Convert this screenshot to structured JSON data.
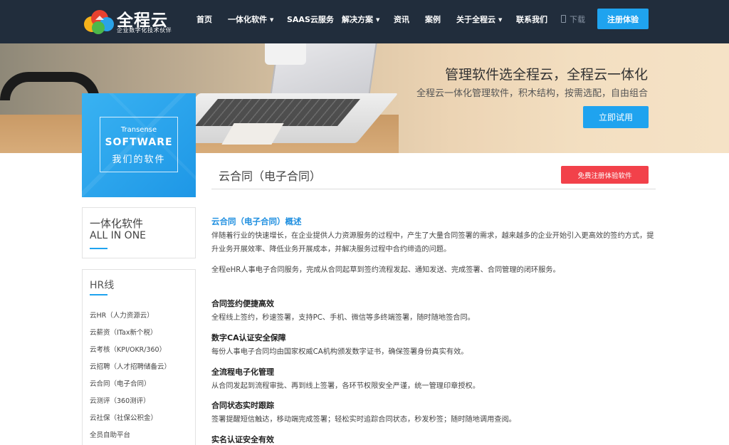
{
  "nav": {
    "logo_title": "全程云",
    "logo_subtitle": "企业数字化技术伙伴",
    "items": [
      {
        "label": "首页",
        "dropdown": false
      },
      {
        "label": "一体化软件",
        "dropdown": true
      },
      {
        "label": "SAAS云服务",
        "dropdown": false
      },
      {
        "label": "解决方案",
        "dropdown": true
      },
      {
        "label": "资讯",
        "dropdown": false
      },
      {
        "label": "案例",
        "dropdown": false
      },
      {
        "label": "关于全程云",
        "dropdown": true
      },
      {
        "label": "联系我们",
        "dropdown": false
      }
    ],
    "download": "下载",
    "register": "注册体验"
  },
  "banner": {
    "title": "管理软件选全程云，全程云一体化",
    "subtitle": "全程云一体化管理软件，积木结构，按需选配，自由组合",
    "button": "立即试用"
  },
  "software_box": {
    "en_small": "Transense",
    "en_big": "SOFTWARE",
    "cn": "我们的软件"
  },
  "sidebar": {
    "allinone_cn": "一体化软件",
    "allinone_en": "ALL IN ONE",
    "hr_title": "HR线",
    "hr_links": [
      "云HR（人力资源云）",
      "云薪资（ITax新个税）",
      "云考核（KPI/OKR/360）",
      "云招聘（人才招聘储备云）",
      "云合同（电子合同）",
      "云测评（360测评）",
      "云社保（社保公积金）",
      "全员自助平台"
    ]
  },
  "main": {
    "title": "云合同（电子合同）",
    "free_button": "免费注册体验软件",
    "overview_title": "云合同（电子合同）概述",
    "para1": "伴随着行业的快速增长，在企业提供人力资源服务的过程中，产生了大量合同签署的需求，越来越多的企业开始引入更高效的签约方式，提升业务开展效率、降低业务开展成本，并解决服务过程中合约缔造的问题。",
    "para2": "全程eHR人事电子合同服务，完成从合同起草到签约流程发起、通知发送、完成签署、合同管理的闭环服务。",
    "features": [
      {
        "title": "合同签约便捷高效",
        "desc": "全程线上签约，秒速签署，支持PC、手机、微信等多终端签署，随时随地签合同。"
      },
      {
        "title": "数字CA认证安全保障",
        "desc": "每份人事电子合同均由国家权威CA机构颁发数字证书，确保签署身份真实有效。"
      },
      {
        "title": "全流程电子化管理",
        "desc": "从合同发起到流程审批、再到线上签署，各环节权限安全严谨，统一管理印章授权。"
      },
      {
        "title": "合同状态实时跟踪",
        "desc": "签署提醒短信触达，移动端完成签署；轻松实时追踪合同状态，秒发秒签；随时随地调用查阅。"
      },
      {
        "title": "实名认证安全有效",
        "desc": ""
      }
    ]
  },
  "colors": {
    "nav_bg": "#212d3c",
    "accent_blue": "#1fa3ef",
    "accent_red": "#f2414a",
    "heading_blue": "#1f8fe0"
  }
}
